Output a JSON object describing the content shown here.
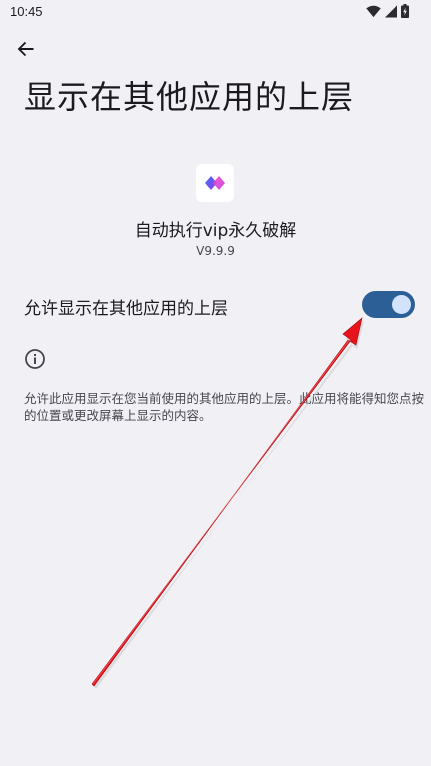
{
  "status_bar": {
    "time": "10:45",
    "icons": [
      "wifi-icon",
      "signal-icon",
      "battery-charging-icon"
    ]
  },
  "header": {
    "back_icon": "arrow-back-icon",
    "title": "显示在其他应用的上层"
  },
  "app": {
    "name": "自动执行vip永久破解",
    "version": "V9.9.9",
    "icon": "app-diamond-icon"
  },
  "permission": {
    "label": "允许显示在其他应用的上层",
    "enabled": true,
    "description": "允许此应用显示在您当前使用的其他应用的上层。此应用将能得知您点按的位置或更改屏幕上显示的内容。"
  },
  "colors": {
    "background": "#f1f0f5",
    "switch_track_on": "#2d5f97",
    "switch_knob_on": "#d3e3fd",
    "annotation_arrow": "#e8141b"
  }
}
